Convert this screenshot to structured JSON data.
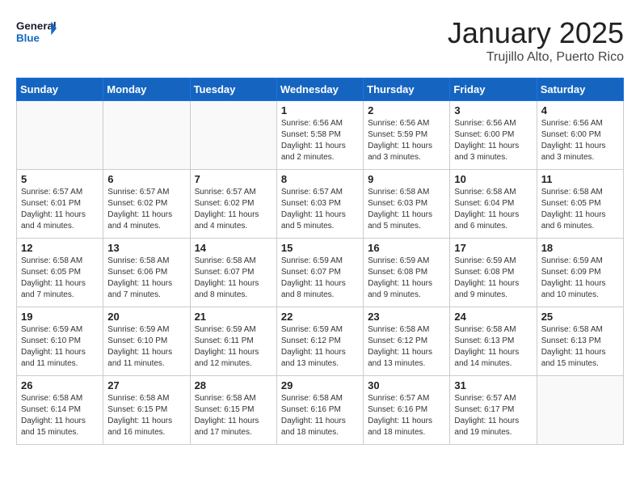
{
  "header": {
    "logo_general": "General",
    "logo_blue": "Blue",
    "month_year": "January 2025",
    "location": "Trujillo Alto, Puerto Rico"
  },
  "days_of_week": [
    "Sunday",
    "Monday",
    "Tuesday",
    "Wednesday",
    "Thursday",
    "Friday",
    "Saturday"
  ],
  "weeks": [
    [
      {
        "day": "",
        "info": ""
      },
      {
        "day": "",
        "info": ""
      },
      {
        "day": "",
        "info": ""
      },
      {
        "day": "1",
        "info": "Sunrise: 6:56 AM\nSunset: 5:58 PM\nDaylight: 11 hours and 2 minutes."
      },
      {
        "day": "2",
        "info": "Sunrise: 6:56 AM\nSunset: 5:59 PM\nDaylight: 11 hours and 3 minutes."
      },
      {
        "day": "3",
        "info": "Sunrise: 6:56 AM\nSunset: 6:00 PM\nDaylight: 11 hours and 3 minutes."
      },
      {
        "day": "4",
        "info": "Sunrise: 6:56 AM\nSunset: 6:00 PM\nDaylight: 11 hours and 3 minutes."
      }
    ],
    [
      {
        "day": "5",
        "info": "Sunrise: 6:57 AM\nSunset: 6:01 PM\nDaylight: 11 hours and 4 minutes."
      },
      {
        "day": "6",
        "info": "Sunrise: 6:57 AM\nSunset: 6:02 PM\nDaylight: 11 hours and 4 minutes."
      },
      {
        "day": "7",
        "info": "Sunrise: 6:57 AM\nSunset: 6:02 PM\nDaylight: 11 hours and 4 minutes."
      },
      {
        "day": "8",
        "info": "Sunrise: 6:57 AM\nSunset: 6:03 PM\nDaylight: 11 hours and 5 minutes."
      },
      {
        "day": "9",
        "info": "Sunrise: 6:58 AM\nSunset: 6:03 PM\nDaylight: 11 hours and 5 minutes."
      },
      {
        "day": "10",
        "info": "Sunrise: 6:58 AM\nSunset: 6:04 PM\nDaylight: 11 hours and 6 minutes."
      },
      {
        "day": "11",
        "info": "Sunrise: 6:58 AM\nSunset: 6:05 PM\nDaylight: 11 hours and 6 minutes."
      }
    ],
    [
      {
        "day": "12",
        "info": "Sunrise: 6:58 AM\nSunset: 6:05 PM\nDaylight: 11 hours and 7 minutes."
      },
      {
        "day": "13",
        "info": "Sunrise: 6:58 AM\nSunset: 6:06 PM\nDaylight: 11 hours and 7 minutes."
      },
      {
        "day": "14",
        "info": "Sunrise: 6:58 AM\nSunset: 6:07 PM\nDaylight: 11 hours and 8 minutes."
      },
      {
        "day": "15",
        "info": "Sunrise: 6:59 AM\nSunset: 6:07 PM\nDaylight: 11 hours and 8 minutes."
      },
      {
        "day": "16",
        "info": "Sunrise: 6:59 AM\nSunset: 6:08 PM\nDaylight: 11 hours and 9 minutes."
      },
      {
        "day": "17",
        "info": "Sunrise: 6:59 AM\nSunset: 6:08 PM\nDaylight: 11 hours and 9 minutes."
      },
      {
        "day": "18",
        "info": "Sunrise: 6:59 AM\nSunset: 6:09 PM\nDaylight: 11 hours and 10 minutes."
      }
    ],
    [
      {
        "day": "19",
        "info": "Sunrise: 6:59 AM\nSunset: 6:10 PM\nDaylight: 11 hours and 11 minutes."
      },
      {
        "day": "20",
        "info": "Sunrise: 6:59 AM\nSunset: 6:10 PM\nDaylight: 11 hours and 11 minutes."
      },
      {
        "day": "21",
        "info": "Sunrise: 6:59 AM\nSunset: 6:11 PM\nDaylight: 11 hours and 12 minutes."
      },
      {
        "day": "22",
        "info": "Sunrise: 6:59 AM\nSunset: 6:12 PM\nDaylight: 11 hours and 13 minutes."
      },
      {
        "day": "23",
        "info": "Sunrise: 6:58 AM\nSunset: 6:12 PM\nDaylight: 11 hours and 13 minutes."
      },
      {
        "day": "24",
        "info": "Sunrise: 6:58 AM\nSunset: 6:13 PM\nDaylight: 11 hours and 14 minutes."
      },
      {
        "day": "25",
        "info": "Sunrise: 6:58 AM\nSunset: 6:13 PM\nDaylight: 11 hours and 15 minutes."
      }
    ],
    [
      {
        "day": "26",
        "info": "Sunrise: 6:58 AM\nSunset: 6:14 PM\nDaylight: 11 hours and 15 minutes."
      },
      {
        "day": "27",
        "info": "Sunrise: 6:58 AM\nSunset: 6:15 PM\nDaylight: 11 hours and 16 minutes."
      },
      {
        "day": "28",
        "info": "Sunrise: 6:58 AM\nSunset: 6:15 PM\nDaylight: 11 hours and 17 minutes."
      },
      {
        "day": "29",
        "info": "Sunrise: 6:58 AM\nSunset: 6:16 PM\nDaylight: 11 hours and 18 minutes."
      },
      {
        "day": "30",
        "info": "Sunrise: 6:57 AM\nSunset: 6:16 PM\nDaylight: 11 hours and 18 minutes."
      },
      {
        "day": "31",
        "info": "Sunrise: 6:57 AM\nSunset: 6:17 PM\nDaylight: 11 hours and 19 minutes."
      },
      {
        "day": "",
        "info": ""
      }
    ]
  ]
}
